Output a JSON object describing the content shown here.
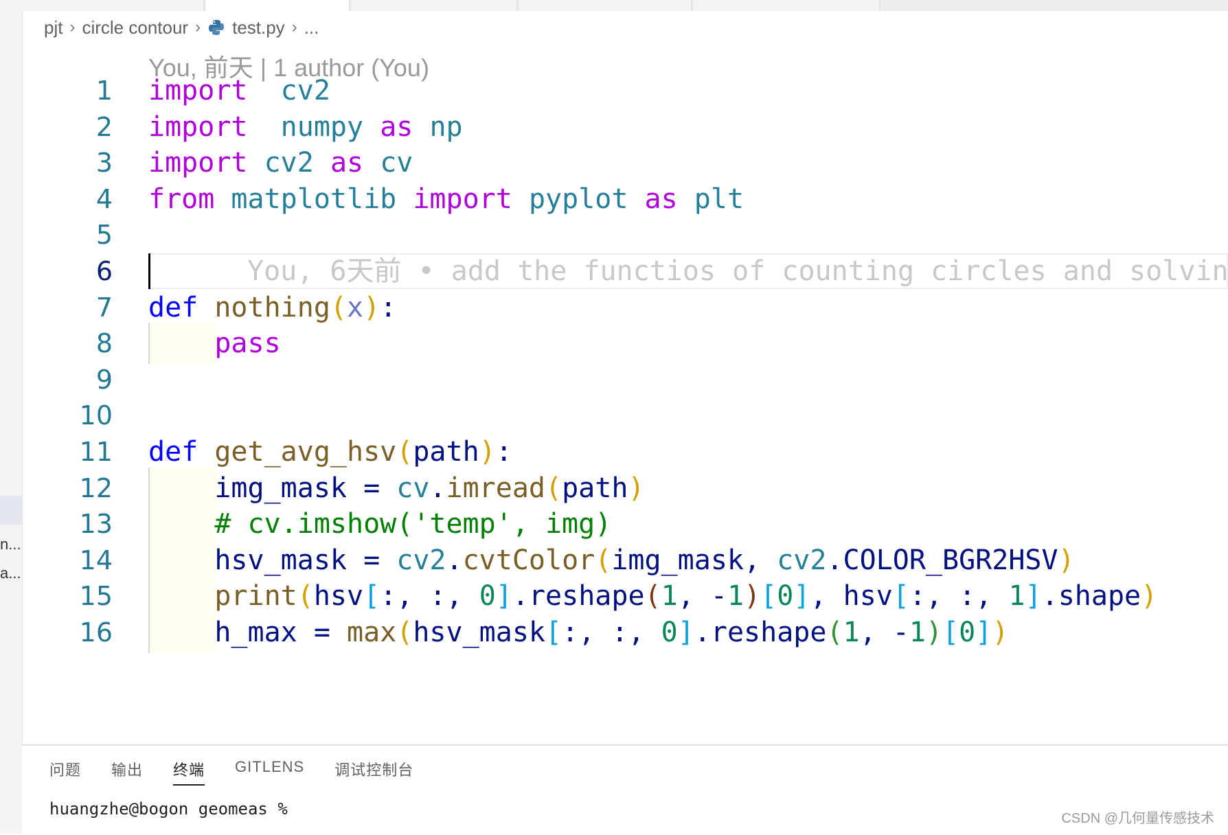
{
  "breadcrumb": {
    "items": [
      "pjt",
      "circle contour",
      "test.py",
      "..."
    ]
  },
  "sidebar": {
    "truncated": [
      "n...",
      "a..."
    ]
  },
  "editor": {
    "blame_header": "You, 前天 | 1 author (You)",
    "active_line": 6,
    "inline_blame": "You, 6天前 • add the functios of counting circles and solvin",
    "lines": [
      {
        "n": "1",
        "segs": [
          [
            "kw",
            "import"
          ],
          [
            "",
            "  "
          ],
          [
            "mod",
            "cv2"
          ]
        ]
      },
      {
        "n": "2",
        "segs": [
          [
            "kw",
            "import"
          ],
          [
            "",
            "  "
          ],
          [
            "mod",
            "numpy"
          ],
          [
            "",
            " "
          ],
          [
            "kw",
            "as"
          ],
          [
            "",
            " "
          ],
          [
            "mod",
            "np"
          ]
        ]
      },
      {
        "n": "3",
        "segs": [
          [
            "kw",
            "import"
          ],
          [
            "",
            " "
          ],
          [
            "mod",
            "cv2"
          ],
          [
            "",
            " "
          ],
          [
            "kw",
            "as"
          ],
          [
            "",
            " "
          ],
          [
            "mod",
            "cv"
          ]
        ]
      },
      {
        "n": "4",
        "segs": [
          [
            "kw",
            "from"
          ],
          [
            "",
            " "
          ],
          [
            "mod",
            "matplotlib"
          ],
          [
            "",
            " "
          ],
          [
            "kw",
            "import"
          ],
          [
            "",
            " "
          ],
          [
            "mod",
            "pyplot"
          ],
          [
            "",
            " "
          ],
          [
            "kw",
            "as"
          ],
          [
            "",
            " "
          ],
          [
            "mod",
            "plt"
          ]
        ]
      },
      {
        "n": "5",
        "segs": []
      },
      {
        "n": "6",
        "segs": []
      },
      {
        "n": "7",
        "segs": [
          [
            "def",
            "def"
          ],
          [
            "",
            " "
          ],
          [
            "fn",
            "nothing"
          ],
          [
            "p1",
            "("
          ],
          [
            "prm",
            "x"
          ],
          [
            "p1",
            ")"
          ],
          [
            "",
            ":"
          ]
        ]
      },
      {
        "n": "8",
        "segs": [
          [
            "",
            "    "
          ],
          [
            "kw",
            "pass"
          ]
        ]
      },
      {
        "n": "9",
        "segs": []
      },
      {
        "n": "10",
        "segs": []
      },
      {
        "n": "11",
        "segs": [
          [
            "def",
            "def"
          ],
          [
            "",
            " "
          ],
          [
            "fn",
            "get_avg_hsv"
          ],
          [
            "p1",
            "("
          ],
          [
            "var",
            "path"
          ],
          [
            "p1",
            ")"
          ],
          [
            "",
            ":"
          ]
        ]
      },
      {
        "n": "12",
        "segs": [
          [
            "",
            "    "
          ],
          [
            "var",
            "img_mask"
          ],
          [
            "",
            " = "
          ],
          [
            "mod",
            "cv"
          ],
          [
            "",
            "."
          ],
          [
            "fn",
            "imread"
          ],
          [
            "p1",
            "("
          ],
          [
            "var",
            "path"
          ],
          [
            "p1",
            ")"
          ]
        ]
      },
      {
        "n": "13",
        "segs": [
          [
            "",
            "    "
          ],
          [
            "cmt",
            "# cv.imshow("
          ],
          [
            "p1",
            ""
          ],
          [
            "cmt",
            "'temp', img"
          ],
          [
            "cmt",
            ")"
          ]
        ]
      },
      {
        "n": "14",
        "segs": [
          [
            "",
            "    "
          ],
          [
            "var",
            "hsv_mask"
          ],
          [
            "",
            " = "
          ],
          [
            "mod",
            "cv2"
          ],
          [
            "",
            "."
          ],
          [
            "fn",
            "cvtColor"
          ],
          [
            "p1",
            "("
          ],
          [
            "var",
            "img_mask"
          ],
          [
            "",
            ", "
          ],
          [
            "mod",
            "cv2"
          ],
          [
            "",
            "."
          ],
          [
            "var",
            "COLOR_BGR2HSV"
          ],
          [
            "p1",
            ")"
          ]
        ]
      },
      {
        "n": "15",
        "segs": [
          [
            "",
            "    "
          ],
          [
            "fn",
            "print"
          ],
          [
            "p1",
            "("
          ],
          [
            "var",
            "hsv"
          ],
          [
            "br",
            "["
          ],
          [
            "",
            ":, :, "
          ],
          [
            "num",
            "0"
          ],
          [
            "br",
            "]"
          ],
          [
            "",
            ".reshape"
          ],
          [
            "p3",
            "("
          ],
          [
            "num",
            "1"
          ],
          [
            "",
            ", -"
          ],
          [
            "num",
            "1"
          ],
          [
            "p3",
            ")"
          ],
          [
            "br",
            "["
          ],
          [
            "num",
            "0"
          ],
          [
            "br",
            "]"
          ],
          [
            "",
            ", "
          ],
          [
            "var",
            "hsv"
          ],
          [
            "br",
            "["
          ],
          [
            "",
            ":, :, "
          ],
          [
            "num",
            "1"
          ],
          [
            "br",
            "]"
          ],
          [
            "",
            ".shape"
          ],
          [
            "p1",
            ")"
          ]
        ]
      },
      {
        "n": "16",
        "segs": [
          [
            "",
            "    "
          ],
          [
            "var",
            "h_max"
          ],
          [
            "",
            " = "
          ],
          [
            "fn",
            "max"
          ],
          [
            "p1",
            "("
          ],
          [
            "var",
            "hsv_mask"
          ],
          [
            "br",
            "["
          ],
          [
            "",
            ":, :, "
          ],
          [
            "num",
            "0"
          ],
          [
            "br",
            "]"
          ],
          [
            "",
            ".reshape"
          ],
          [
            "p2",
            "("
          ],
          [
            "num",
            "1"
          ],
          [
            "",
            ", -"
          ],
          [
            "num",
            "1"
          ],
          [
            "p2",
            ")"
          ],
          [
            "br",
            "["
          ],
          [
            "num",
            "0"
          ],
          [
            "br",
            "]"
          ],
          [
            "p1",
            ")"
          ]
        ]
      }
    ]
  },
  "panel": {
    "tabs": [
      "问题",
      "输出",
      "终端",
      "GITLENS",
      "调试控制台"
    ],
    "active_tab": "终端",
    "terminal_prompt": "huangzhe@bogon geomeas % "
  },
  "watermark": "CSDN @几何量传感技术"
}
